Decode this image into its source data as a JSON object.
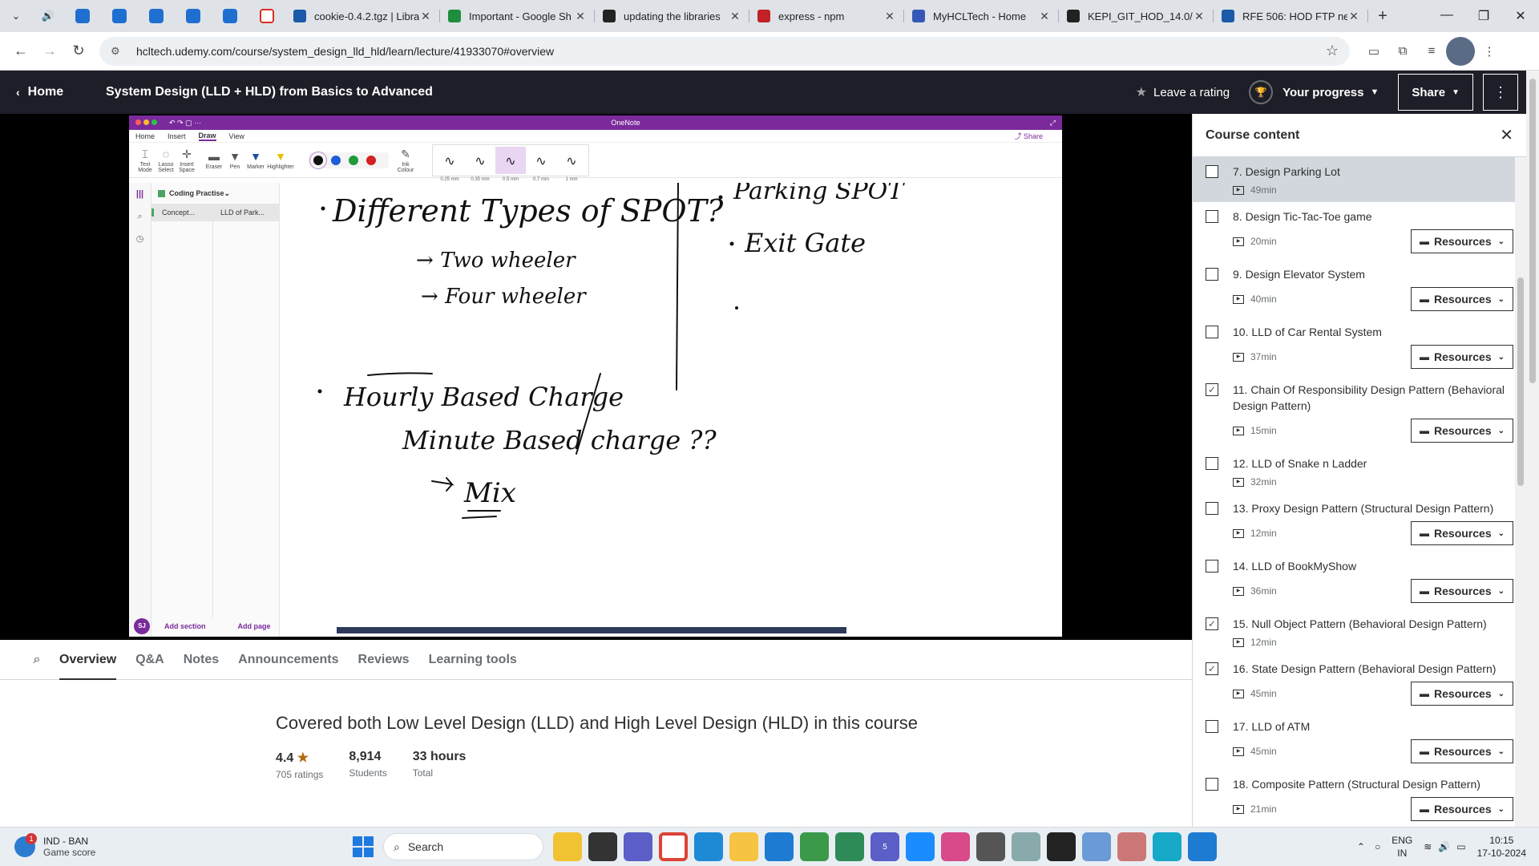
{
  "browser": {
    "tabs": [
      {
        "title": "cookie-0.4.2.tgz | Libra",
        "color": "#1a5aa8"
      },
      {
        "title": "Important - Google Sh",
        "color": "#1e8e3e"
      },
      {
        "title": "updating the libraries",
        "color": "#222222"
      },
      {
        "title": "express - npm",
        "color": "#c12127"
      },
      {
        "title": "MyHCLTech - Home",
        "color": "#3557b7"
      },
      {
        "title": "KEPI_GIT_HOD_14.0/H",
        "color": "#222222"
      },
      {
        "title": "RFE 506: HOD FTP nee",
        "color": "#1a5aa8"
      }
    ],
    "url": "hcltech.udemy.com/course/system_design_lld_hld/learn/lecture/41933070#overview"
  },
  "header": {
    "home_label": "Home",
    "course_title": "System Design (LLD + HLD) from Basics to Advanced",
    "rating_label": "Leave a rating",
    "progress_label": "Your progress",
    "share_label": "Share"
  },
  "onenote": {
    "app_title": "OneNote",
    "menu": [
      "Home",
      "Insert",
      "Draw",
      "View"
    ],
    "share": "Share",
    "tools": [
      "Text Mode",
      "Lasso Select",
      "Insert Space",
      "Eraser",
      "Pen",
      "Marker",
      "Highlighter"
    ],
    "ink_colour": "Ink Colour",
    "strokes": [
      "0.25 mm",
      "0.35 mm",
      "0.5 mm",
      "0.7 mm",
      "1 mm"
    ],
    "notebook": "Coding Practise",
    "section": "Concept...",
    "page": "LLD of Park...",
    "user_initials": "SJ",
    "add_section": "Add section",
    "add_page": "Add page",
    "ink_text": {
      "l1": "Different Types of SPOT?",
      "l2": "Two wheeler",
      "l3": "Four wheeler",
      "l4": "Hourly Based Charge",
      "l5": "Minute Based charge ??",
      "l6": "Mix",
      "r1": "Parking SPOT",
      "r2": "Exit Gate"
    }
  },
  "course_tabs": [
    "Overview",
    "Q&A",
    "Notes",
    "Announcements",
    "Reviews",
    "Learning tools"
  ],
  "overview": {
    "headline": "Covered both Low Level Design (LLD) and High Level Design (HLD) in this course",
    "rating": "4.4",
    "rating_label": "705 ratings",
    "students": "8,914",
    "students_label": "Students",
    "hours": "33 hours",
    "hours_label": "Total"
  },
  "sidebar": {
    "title": "Course content",
    "resources_label": "Resources",
    "lectures": [
      {
        "title": "7. Design Parking Lot",
        "duration": "49min",
        "checked": false,
        "resources": false,
        "current": true
      },
      {
        "title": "8. Design Tic-Tac-Toe game",
        "duration": "20min",
        "checked": false,
        "resources": true
      },
      {
        "title": "9. Design Elevator System",
        "duration": "40min",
        "checked": false,
        "resources": true
      },
      {
        "title": "10. LLD of Car Rental System",
        "duration": "37min",
        "checked": false,
        "resources": true
      },
      {
        "title": "11. Chain Of Responsibility Design Pattern (Behavioral Design Pattern)",
        "duration": "15min",
        "checked": true,
        "resources": true
      },
      {
        "title": "12. LLD of Snake n Ladder",
        "duration": "32min",
        "checked": false,
        "resources": false
      },
      {
        "title": "13. Proxy Design Pattern (Structural Design Pattern)",
        "duration": "12min",
        "checked": false,
        "resources": true
      },
      {
        "title": "14. LLD of BookMyShow",
        "duration": "36min",
        "checked": false,
        "resources": true
      },
      {
        "title": "15. Null Object Pattern (Behavioral Design Pattern)",
        "duration": "12min",
        "checked": true,
        "resources": false
      },
      {
        "title": "16. State Design Pattern (Behavioral Design Pattern)",
        "duration": "45min",
        "checked": true,
        "resources": true
      },
      {
        "title": "17. LLD of ATM",
        "duration": "45min",
        "checked": false,
        "resources": true
      },
      {
        "title": "18. Composite Pattern (Structural Design Pattern)",
        "duration": "21min",
        "checked": false,
        "resources": true
      }
    ]
  },
  "taskbar": {
    "weather_badge": "1",
    "weather_line1": "IND - BAN",
    "weather_line2": "Game score",
    "search_label": "Search",
    "teams_badge": "5",
    "lang_line1": "ENG",
    "lang_line2": "IN",
    "time": "10:15",
    "date": "17-10-2024"
  }
}
